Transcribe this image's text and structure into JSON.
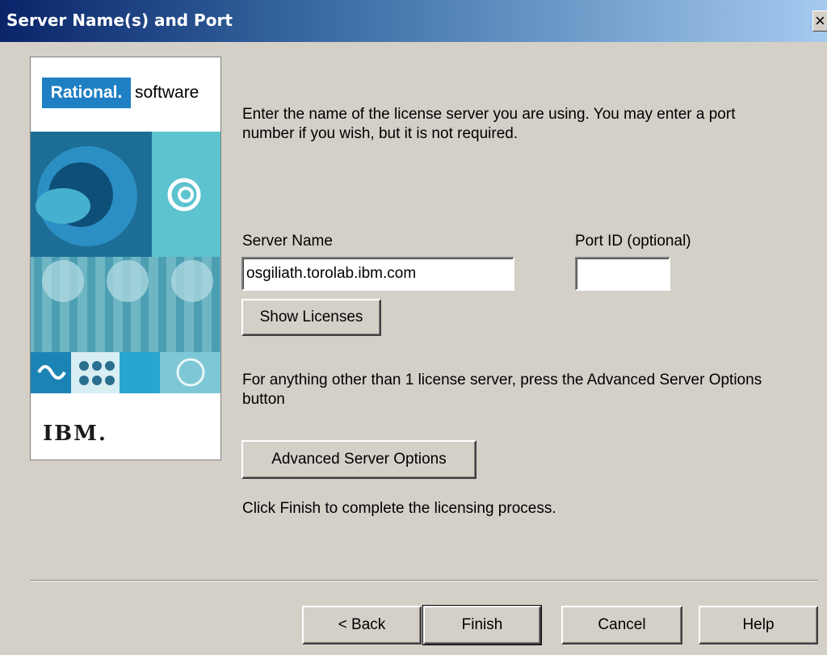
{
  "window": {
    "title": "Server Name(s) and Port",
    "close_glyph": "×"
  },
  "side_panel": {
    "brand_rational": "Rational.",
    "brand_software": "software",
    "brand_ibm": "IBM."
  },
  "main": {
    "intro_text": "Enter the name of the license server you are using.  You may enter a port number if you wish, but it is not required.",
    "server_name_label": "Server Name",
    "server_name_value": "osgiliath.torolab.ibm.com",
    "port_label": "Port ID (optional)",
    "port_value": "",
    "show_licenses_label": "Show Licenses",
    "advanced_note": "For anything other than 1 license server, press the Advanced Server Options button",
    "advanced_button_label": "Advanced Server Options",
    "finish_note": "Click Finish to complete the licensing process."
  },
  "footer": {
    "back_label": "< Back",
    "finish_label": "Finish",
    "cancel_label": "Cancel",
    "help_label": "Help"
  },
  "colors": {
    "titlebar_start": "#0a246a",
    "titlebar_end": "#a6caf0",
    "dialog_bg": "#d4d0c8",
    "rational_blue": "#1f7fc3"
  }
}
